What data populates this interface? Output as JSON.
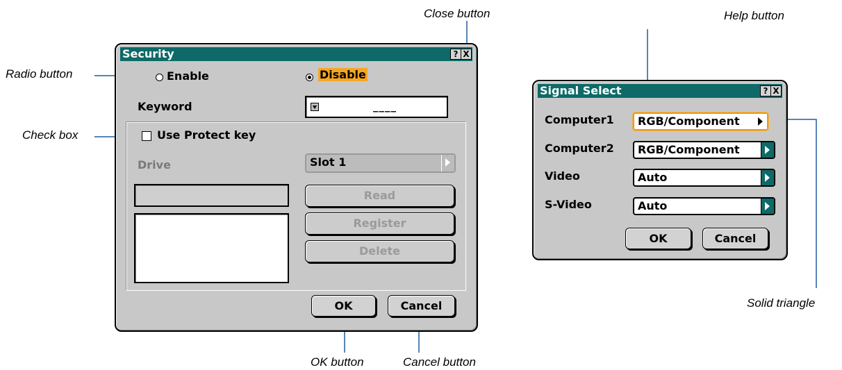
{
  "callouts": {
    "close_button": "Close button",
    "radio_button": "Radio button",
    "check_box": "Check box",
    "ok_button": "OK button",
    "cancel_button": "Cancel button",
    "help_button": "Help button",
    "solid_triangle": "Solid triangle"
  },
  "security": {
    "title": "Security",
    "help": "?",
    "close": "X",
    "enable_label": "Enable",
    "enable_checked": false,
    "disable_label": "Disable",
    "disable_checked": true,
    "keyword_label": "Keyword",
    "keyword_value": "____",
    "use_protect_key_label": "Use Protect key",
    "use_protect_key_checked": false,
    "drive_label": "Drive",
    "drive_value": "Slot 1",
    "read_label": "Read",
    "register_label": "Register",
    "delete_label": "Delete",
    "ok_label": "OK",
    "cancel_label": "Cancel"
  },
  "signal_select": {
    "title": "Signal Select",
    "help": "?",
    "close": "X",
    "rows": [
      {
        "label": "Computer1",
        "value": "RGB/Component"
      },
      {
        "label": "Computer2",
        "value": "RGB/Component"
      },
      {
        "label": "Video",
        "value": "Auto"
      },
      {
        "label": "S-Video",
        "value": "Auto"
      }
    ],
    "ok_label": "OK",
    "cancel_label": "Cancel"
  },
  "colors": {
    "titlebar": "#0d6a68",
    "highlight": "#f5a623",
    "dialog_bg": "#c8c8c8",
    "callout_line": "#1f5c9e"
  }
}
